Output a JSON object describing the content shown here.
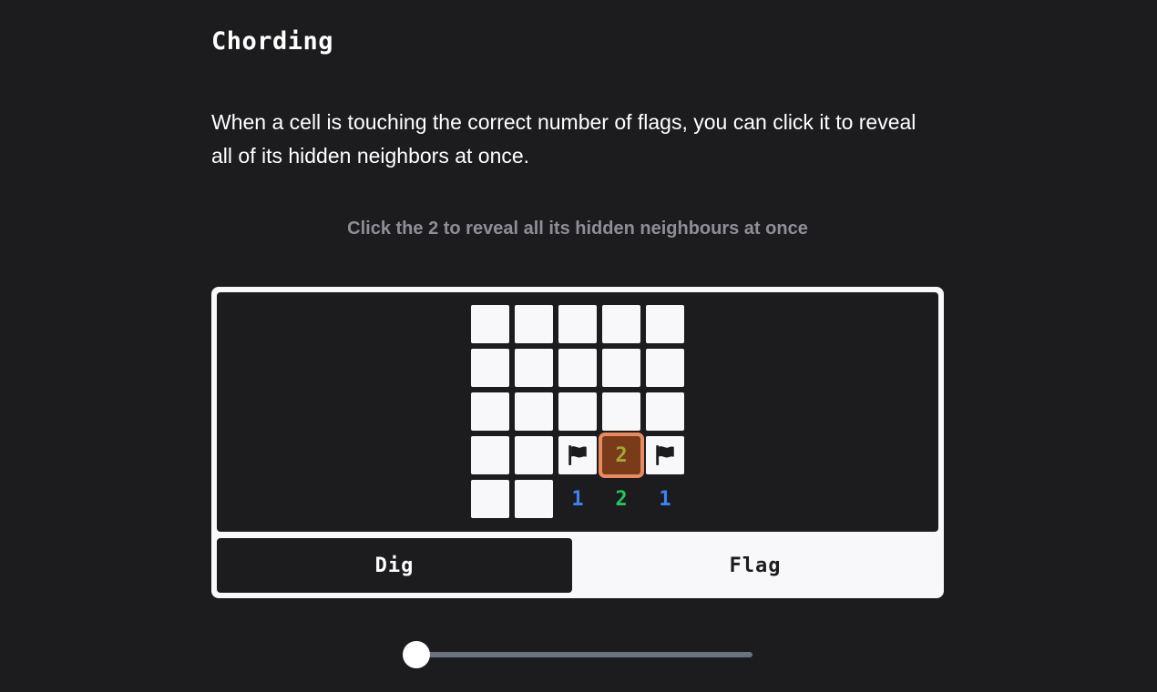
{
  "title": "Chording",
  "intro": "When a cell is touching the correct number of flags, you can click it to reveal all of its hidden neighbors at once.",
  "instruction": "Click the 2 to reveal all its hidden neighbours at once",
  "board": {
    "rows": 5,
    "cols": 5,
    "cells": [
      [
        "hidden",
        "hidden",
        "hidden",
        "hidden",
        "hidden"
      ],
      [
        "hidden",
        "hidden",
        "hidden",
        "hidden",
        "hidden"
      ],
      [
        "hidden",
        "hidden",
        "hidden",
        "hidden",
        "hidden"
      ],
      [
        "hidden",
        "hidden",
        "flag",
        "2",
        "flag"
      ],
      [
        "hidden",
        "hidden",
        "1",
        "2",
        "1"
      ]
    ],
    "highlight": [
      3,
      3
    ],
    "number_colors": {
      "1": "#3b82f6",
      "2": "#22c55e",
      "highlight": "#a3a832"
    },
    "flag_icon": "flag-icon"
  },
  "modes": {
    "dig_label": "Dig",
    "flag_label": "Flag",
    "active": "dig"
  },
  "slider": {
    "value": 0
  }
}
